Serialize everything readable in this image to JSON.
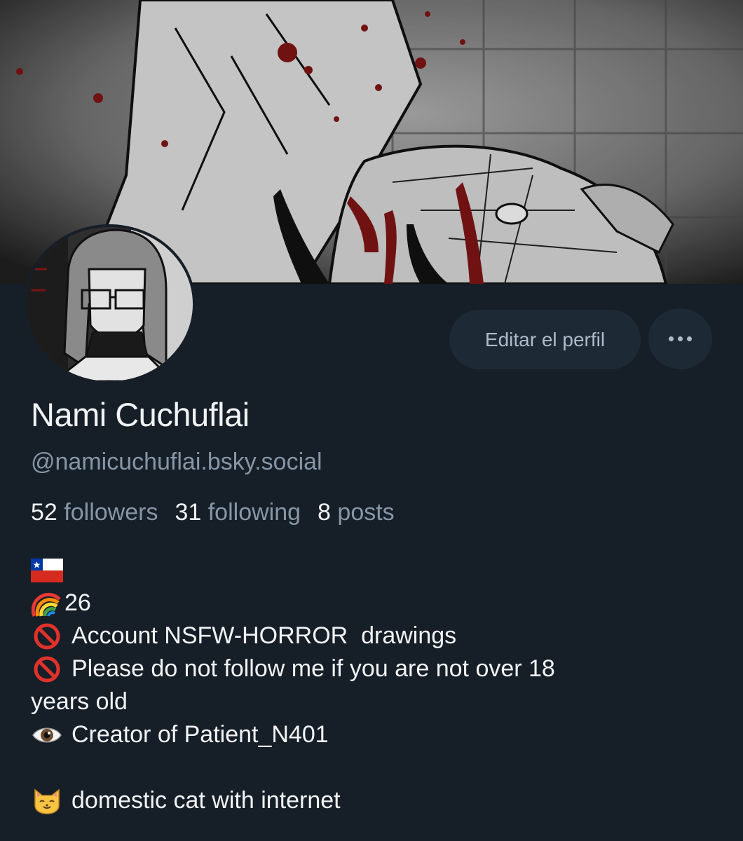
{
  "profile": {
    "display_name": "Nami Cuchuflai",
    "handle": "@namicuchuflai.bsky.social"
  },
  "actions": {
    "edit_label": "Editar el perfil",
    "more_label": "More options"
  },
  "stats": {
    "followers_count": "52",
    "followers_label": "followers",
    "following_count": "31",
    "following_label": "following",
    "posts_count": "8",
    "posts_label": "posts"
  },
  "bio": {
    "line_flag_icon": "chile-flag-icon",
    "line_age_icon": "rainbow-icon",
    "line_age": "26",
    "line_nsfw_icon": "prohibited-icon",
    "line_nsfw": "Account NSFW-HORROR  drawings",
    "line_follow_icon": "prohibited-icon",
    "line_follow_a": "Please do not follow me if you are not over 18",
    "line_follow_b": "years old",
    "line_creator_icon": "eye-icon",
    "line_creator": "Creator of Patient_N401",
    "line_cat_icon": "cat-face-icon",
    "line_cat": "domestic cat with internet"
  },
  "colors": {
    "background": "#161e27",
    "button_bg": "#1e2936",
    "muted_text": "#8796a7",
    "primary_text": "#f1f3f5"
  }
}
